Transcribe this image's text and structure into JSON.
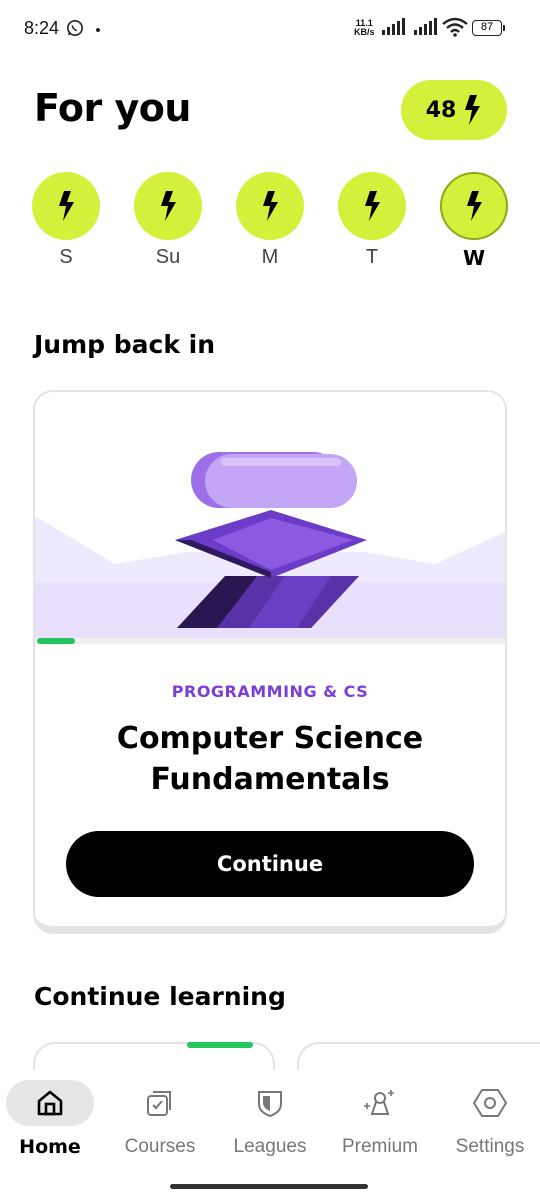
{
  "status_bar": {
    "time": "8:24",
    "net_speed_value": "11.1",
    "net_speed_unit": "KB/s",
    "battery": "87"
  },
  "header": {
    "title": "For you",
    "streak_count": "48"
  },
  "week": [
    {
      "label": "S",
      "today": false
    },
    {
      "label": "Su",
      "today": false
    },
    {
      "label": "M",
      "today": false
    },
    {
      "label": "T",
      "today": false
    },
    {
      "label": "W",
      "today": true
    }
  ],
  "jump_back": {
    "section_title": "Jump back in",
    "card": {
      "category": "PROGRAMMING & CS",
      "title_line1": "Computer Science",
      "title_line2": "Fundamentals",
      "button_label": "Continue",
      "progress_fraction": 0.08
    }
  },
  "continue_learning": {
    "section_title": "Continue learning"
  },
  "bottom_nav": {
    "items": [
      {
        "label": "Home",
        "icon": "home-icon",
        "active": true
      },
      {
        "label": "Courses",
        "icon": "courses-icon",
        "active": false
      },
      {
        "label": "Leagues",
        "icon": "shield-icon",
        "active": false
      },
      {
        "label": "Premium",
        "icon": "premium-icon",
        "active": false
      },
      {
        "label": "Settings",
        "icon": "settings-icon",
        "active": false
      }
    ]
  },
  "colors": {
    "accent_lime": "#d4f03a",
    "category_purple": "#7b3fd6",
    "progress_green": "#22c55e"
  }
}
